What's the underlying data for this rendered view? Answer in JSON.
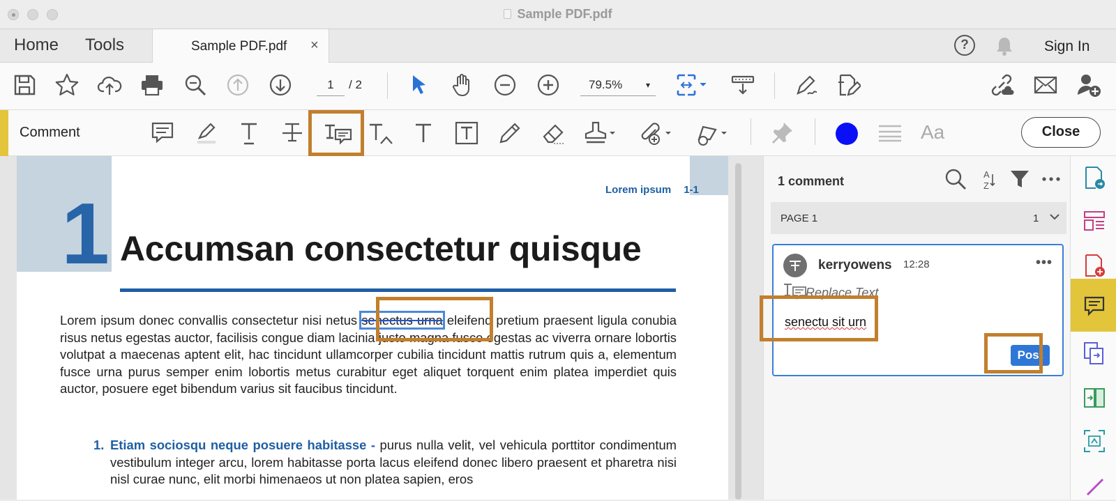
{
  "window": {
    "title": "Sample PDF.pdf"
  },
  "tabs": {
    "home": "Home",
    "tools": "Tools",
    "document": "Sample PDF.pdf",
    "close_tab": "×"
  },
  "header": {
    "sign_in": "Sign In",
    "help": "?"
  },
  "toolbar": {
    "page_current": "1",
    "page_total": "/ 2",
    "zoom": "79.5%",
    "zoom_arrow": "▾"
  },
  "comment_toolbar": {
    "label": "Comment",
    "aa": "Aa",
    "close": "Close",
    "active_color": "#0a10f6",
    "highlight_color": "#c27f2d"
  },
  "document": {
    "running_head": "Lorem ipsum",
    "running_page": "1-1",
    "chapter_number": "1",
    "title": "Accumsan consectetur quisque",
    "para_before": "Lorem ipsum donec convallis consectetur nisi netus ",
    "para_struck": "senectus urna",
    "para_after": " eleifend pretium praesent ligula conubia risus netus egestas auctor, facilisis congue diam lacinia justo magna fusce egestas ac viverra ornare lobortis volutpat a maecenas aptent elit, hac tincidunt ullamcorper cubilia tincidunt mattis rutrum quis a, elementum fusce urna purus semper enim lobortis metus curabitur eget aliquet torquent enim platea imperdiet quis auctor, posuere eget bibendum varius sit faucibus tincidunt.",
    "list_num": "1.",
    "list_head": "Etiam sociosqu neque posuere habitasse -",
    "list_text": " purus nulla velit, vel vehicula porttitor condimentum vestibulum integer arcu, lorem habitasse porta lacus eleifend donec libero praesent et pharetra nisi nisl curae nunc, elit morbi himenaeos ut non platea sapien, eros"
  },
  "comments_pane": {
    "count": "1 comment",
    "page_label": "PAGE 1",
    "page_count": "1",
    "comment": {
      "author": "kerryowens",
      "time": "12:28",
      "more": "•••",
      "type": "Replace Text",
      "text": "senectu sit urn",
      "post": "Post"
    }
  }
}
